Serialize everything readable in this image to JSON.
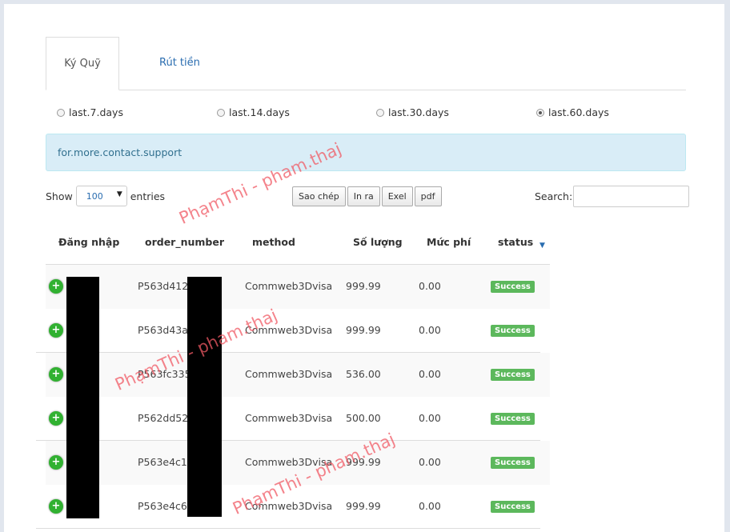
{
  "tabs": [
    {
      "label": "Ký Quỹ",
      "active": true
    },
    {
      "label": "Rút tiền",
      "active": false
    }
  ],
  "ranges": [
    {
      "label": "last.7.days",
      "selected": false
    },
    {
      "label": "last.14.days",
      "selected": false
    },
    {
      "label": "last.30.days",
      "selected": false
    },
    {
      "label": "last.60.days",
      "selected": true
    }
  ],
  "alert": "for.more.contact.support",
  "length": {
    "show": "Show",
    "value": "100",
    "entries": "entries"
  },
  "buttons": [
    "Sao chép",
    "In ra",
    "Exel",
    "pdf"
  ],
  "search": {
    "label": "Search:",
    "value": ""
  },
  "columns": [
    "Đăng nhập",
    "order_number",
    "method",
    "Số lượng",
    "Mức phí",
    "status"
  ],
  "rows": [
    {
      "order": "P563d4122",
      "method": "Commweb3Dvisa",
      "amount": "999.99",
      "fee": "0.00",
      "status": "Success"
    },
    {
      "order": "P563d43a5",
      "method": "Commweb3Dvisa",
      "amount": "999.99",
      "fee": "0.00",
      "status": "Success"
    },
    {
      "order": "P563fc335",
      "method": "Commweb3Dvisa",
      "amount": "536.00",
      "fee": "0.00",
      "status": "Success"
    },
    {
      "order": "P562dd520",
      "method": "Commweb3Dvisa",
      "amount": "500.00",
      "fee": "0.00",
      "status": "Success"
    },
    {
      "order": "P563e4c19",
      "method": "Commweb3Dvisa",
      "amount": "999.99",
      "fee": "0.00",
      "status": "Success"
    },
    {
      "order": "P563e4c6c",
      "method": "Commweb3Dvisa",
      "amount": "999.99",
      "fee": "0.00",
      "status": "Success"
    }
  ],
  "watermark": "PhạmThi - pham.thaj",
  "colors": {
    "accent": "#2a6db0",
    "success": "#5cb85c",
    "expand": "#31b131",
    "alert_bg": "#d9edf7"
  }
}
